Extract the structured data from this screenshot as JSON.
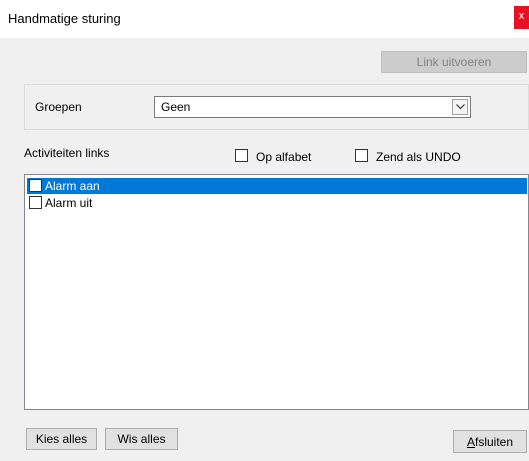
{
  "window": {
    "title": "Handmatige sturing",
    "close_label": "x"
  },
  "toolbar": {
    "execute_label": "Link uitvoeren"
  },
  "groups": {
    "label": "Groepen",
    "selected": "Geen"
  },
  "activities": {
    "label": "Activiteiten links",
    "alphabetical_label": "Op alfabet",
    "alphabetical_checked": false,
    "undo_label": "Zend als UNDO",
    "undo_checked": false,
    "items": [
      {
        "label": "Alarm aan",
        "checked": false,
        "selected": true
      },
      {
        "label": "Alarm uit",
        "checked": false,
        "selected": false
      }
    ]
  },
  "footer": {
    "select_all_label": "Kies alles",
    "clear_all_label": "Wis alles",
    "close_prefix": "A",
    "close_rest": "fsluiten"
  }
}
